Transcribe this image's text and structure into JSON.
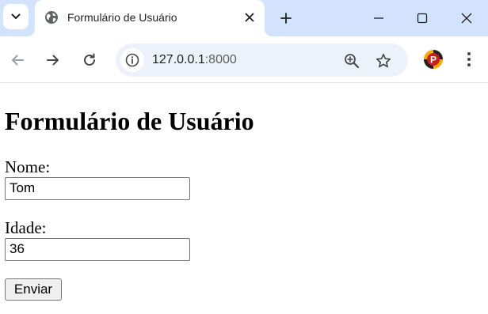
{
  "browser": {
    "tab": {
      "title": "Formulário de Usuário",
      "favicon": "globe-icon"
    },
    "address_bar": {
      "host": "127.0.0.1",
      "port": ":8000"
    }
  },
  "page": {
    "heading": "Formulário de Usuário",
    "fields": {
      "nome_label": "Nome:",
      "nome_value": "Tom",
      "idade_label": "Idade:",
      "idade_value": "36"
    },
    "submit_label": "Enviar"
  },
  "colors": {
    "tabstrip_bg": "#d3e3fd",
    "omnibox_bg": "#edf2fa",
    "icon_gray": "#474747",
    "extension_badge_red": "#c5221f",
    "extension_badge_yellow": "#f9ab00"
  }
}
